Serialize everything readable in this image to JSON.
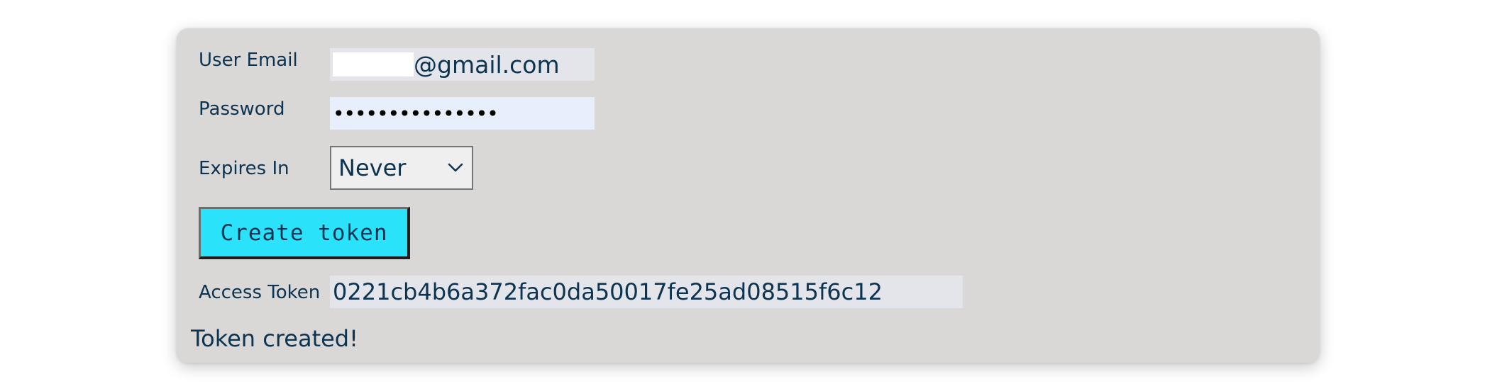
{
  "form": {
    "email": {
      "label": "User Email",
      "value_suffix": "@gmail.com"
    },
    "password": {
      "label": "Password",
      "masked_value": "•••••••••••••••"
    },
    "expires": {
      "label": "Expires In",
      "selected": "Never"
    },
    "create_button": {
      "label": "Create token"
    },
    "access_token": {
      "label": "Access Token",
      "value": "0221cb4b6a372fac0da50017fe25ad08515f6c12"
    },
    "status": {
      "message": "Token created!"
    }
  },
  "colors": {
    "card_bg": "#d9d8d7",
    "text": "#0c3350",
    "button_bg": "#2be2fb",
    "password_bg": "#e7effd",
    "field_bg": "#e3e5ea"
  },
  "icons": {
    "select_arrow": "chevron-down-icon"
  }
}
